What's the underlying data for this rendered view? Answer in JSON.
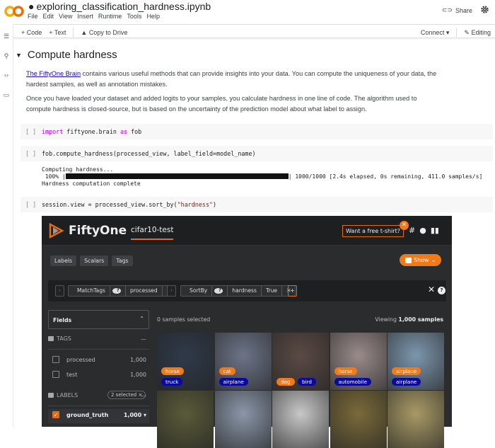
{
  "colab": {
    "filename": "exploring_classification_hardness.ipynb",
    "menu": [
      "File",
      "Edit",
      "View",
      "Insert",
      "Runtime",
      "Tools",
      "Help"
    ],
    "share_label": "Share",
    "toolbar": {
      "add_code": "+ Code",
      "add_text": "+ Text",
      "copy_to_drive": "Copy to Drive",
      "connect": "Connect",
      "editing": "Editing"
    }
  },
  "section": {
    "title": "Compute hardness",
    "para1_link": "The FiftyOne Brain",
    "para1_line1": " contains various useful methods that can provide insights into your data. You can compute the uniqueness of your data, the",
    "para1_line2": "hardest samples, as well as annotation mistakes.",
    "para2_line1": "Once you have loaded your dataset and added logits to your samples, you calculate hardness in one line of code. The algorithm used to",
    "para2_line2": "compute hardness is closed-source, but is based on the uncertainty of the prediction model about what label to assign."
  },
  "cells": [
    {
      "bracket": "[ ]",
      "kw1": "import",
      "mid": " fiftyone.brain ",
      "kw2": "as",
      "end": " fob"
    },
    {
      "bracket": "[ ]",
      "code": "fob.compute_hardness(processed_view, label_field=model_name)"
    },
    {
      "bracket": "[ ]",
      "pre": "session.view = processed_view.sort_by(",
      "str": "\"hardness\"",
      "post": ")"
    }
  ],
  "output": {
    "line1": "Computing hardness...",
    "pct": " 100% |",
    "progress_value": 1.0,
    "stats": "| 1000/1000 [2.4s elapsed, 0s remaining, 411.0 samples/s]",
    "line3": "Hardness computation complete"
  },
  "fiftyone": {
    "brand": "FiftyOne",
    "dataset": "cifar10-test",
    "tshirt": "Want a free t-shirt?",
    "tabs": [
      "Labels",
      "Scalars",
      "Tags"
    ],
    "show_label": "Show",
    "stages": [
      {
        "name": "MatchTags",
        "params": [
          "processed"
        ]
      },
      {
        "name": "SortBy",
        "params": [
          "hardness",
          "True"
        ]
      }
    ],
    "fields_label": "Fields",
    "tags_header": "TAGS",
    "tags": [
      {
        "name": "processed",
        "count": "1,000"
      },
      {
        "name": "test",
        "count": "1,000"
      }
    ],
    "labels_header": "LABELS",
    "labels_selected": "2 selected ×",
    "label_fields": [
      {
        "name": "ground_truth",
        "count": "1,000",
        "checked": true
      }
    ],
    "samples_selected": "0 samples selected",
    "viewing_prefix": "Viewing ",
    "viewing_count": "1,000 samples",
    "tiles": [
      {
        "tags": [
          "horse",
          "truck"
        ],
        "bg": "#2f3a4a"
      },
      {
        "tags": [
          "cat",
          "airplane"
        ],
        "bg": "#6c7487"
      },
      {
        "tags": [
          "dog",
          "bird"
        ],
        "bg": "#5a4a44"
      },
      {
        "tags": [
          "horse",
          "automobile"
        ],
        "bg": "#9a8c8a"
      },
      {
        "tags": [
          "airplane",
          "airplane"
        ],
        "bg": "#7d96ad"
      },
      {
        "tags": [],
        "bg": "#5a5a3a"
      },
      {
        "tags": [],
        "bg": "#8a96a8"
      },
      {
        "tags": [],
        "bg": "#c8c8c8"
      },
      {
        "tags": [],
        "bg": "#7a6a3a"
      },
      {
        "tags": [],
        "bg": "#a89a66"
      }
    ],
    "colors": {
      "accent": "#f07a1a",
      "prediction_tag": "#0a0a9c"
    }
  }
}
